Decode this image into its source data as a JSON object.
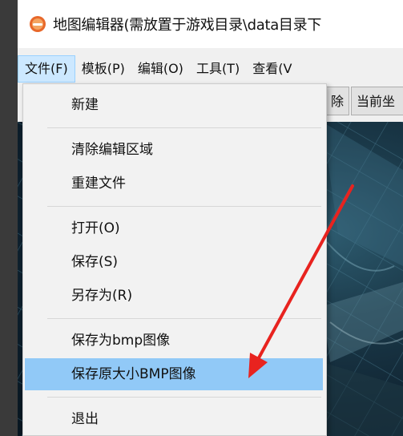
{
  "window": {
    "title": "地图编辑器(需放置于游戏目录\\data目录下"
  },
  "menubar": {
    "items": [
      {
        "label": "文件(F)"
      },
      {
        "label": "模板(P)"
      },
      {
        "label": "编辑(O)"
      },
      {
        "label": "工具(T)"
      },
      {
        "label": "查看(V"
      }
    ]
  },
  "toolbar": {
    "delete_label": "除",
    "coords_label": "当前坐"
  },
  "file_menu": {
    "items": [
      {
        "label": "新建"
      },
      {
        "label": "清除编辑区域"
      },
      {
        "label": "重建文件"
      },
      {
        "label": "打开(O)"
      },
      {
        "label": "保存(S)"
      },
      {
        "label": "另存为(R)"
      },
      {
        "label": "保存为bmp图像"
      },
      {
        "label": "保存原大小BMP图像"
      },
      {
        "label": "退出"
      }
    ],
    "highlighted": "保存原大小BMP图像"
  },
  "colors": {
    "highlight": "#91c9f7",
    "arrow": "#e8231f",
    "active_menu": "#cce8ff"
  }
}
